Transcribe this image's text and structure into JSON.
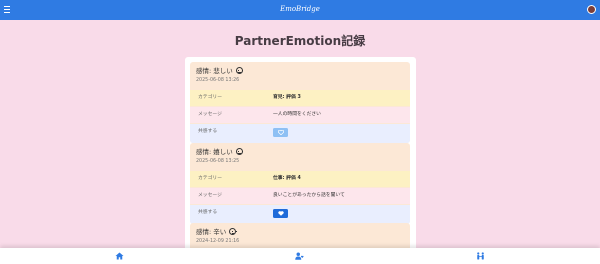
{
  "app": {
    "brand": "EmoBridge"
  },
  "page": {
    "title": "PartnerEmotion記録"
  },
  "labels": {
    "category": "カテゴリー",
    "message": "メッセージ",
    "support": "共感する"
  },
  "records": [
    {
      "emotion": "感情: 悲しい",
      "timestamp": "2025-06-08 13:26",
      "category_value": "育児: 評価 3",
      "message_value": "一人の時間をください",
      "support_state": "inactive"
    },
    {
      "emotion": "感情: 嬉しい",
      "timestamp": "2025-06-08 13:25",
      "category_value": "仕事: 評価 4",
      "message_value": "良いことがあったから話を聞いて",
      "support_state": "active"
    },
    {
      "emotion": "感情: 辛い",
      "timestamp": "2024-12-09 21:16"
    }
  ],
  "icons": {
    "menu": "hamburger-menu-icon",
    "avatar": "user-avatar-icon",
    "emotion_face": "face-icon",
    "support": "heart-icon",
    "footer_home": "home-icon",
    "footer_partner": "user-heart-icon",
    "footer_couple": "couple-icon"
  },
  "colors": {
    "nav": "#2f7be3",
    "page_background": "#f9dbe9",
    "record_background": "#fce8d6",
    "category_row": "#fdf1c3",
    "message_row": "#fde6ec",
    "support_row": "#e9eefe",
    "support_active": "#1f6bd9",
    "support_inactive": "#8ec0f4"
  }
}
